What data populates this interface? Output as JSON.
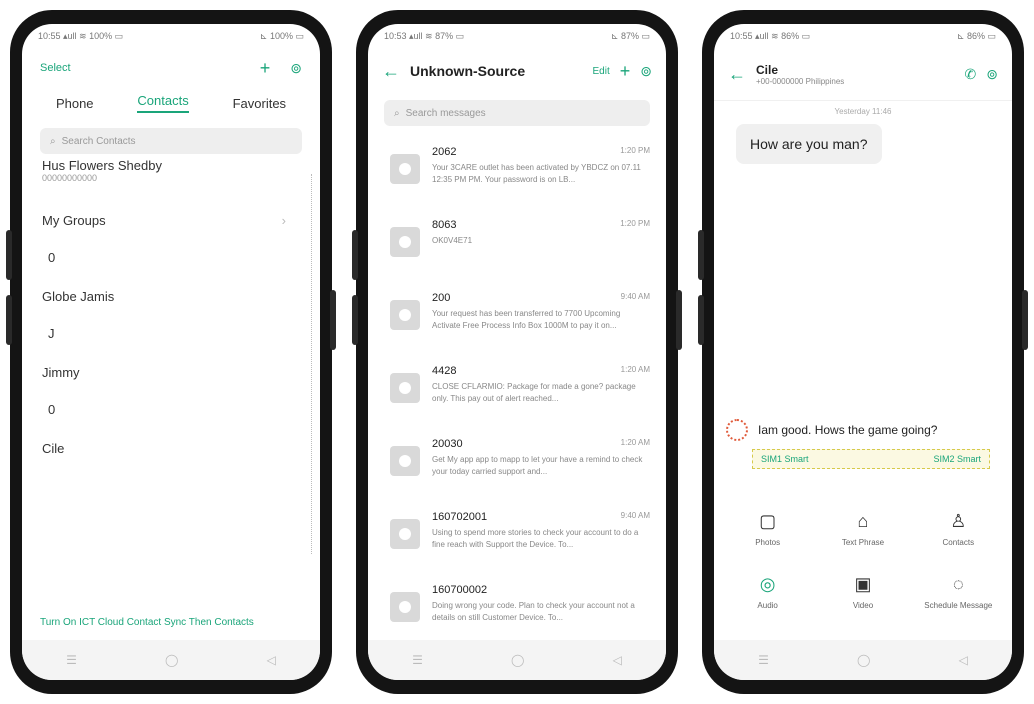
{
  "accent": "#1aa57a",
  "phone1": {
    "status_left": "10:55 ▴ull ≋ 100% ▭",
    "status_right": "⊾ 100% ▭",
    "select_label": "Select",
    "tabs": [
      "Phone",
      "Contacts",
      "Favorites"
    ],
    "search_placeholder": "Search Contacts",
    "owner_name": "Hus Flowers Shedby",
    "owner_sub": "00000000000",
    "groups": [
      {
        "name": "My Groups",
        "count": ""
      },
      {
        "name": "",
        "count": "0"
      },
      {
        "name": "Globe Jamis",
        "count": "J"
      },
      {
        "name": "Jimmy",
        "count": "0"
      },
      {
        "name": "Cile",
        "count": ""
      }
    ],
    "footer_link": "Turn On ICT Cloud Contact Sync Then Contacts"
  },
  "phone2": {
    "status_left": "10:53 ▴ull ≋ 87% ▭",
    "status_right": "⊾ 87% ▭",
    "title": "Unknown-Source",
    "edit_label": "Edit",
    "search_placeholder": "Search messages",
    "messages": [
      {
        "sender": "2062",
        "time": "1:20 PM",
        "text": "Your 3CARE outlet has been activated by YBDCZ on 07.11 12:35 PM PM. Your password is on LB..."
      },
      {
        "sender": "8063",
        "time": "1:20 PM",
        "text": "OK0V4E71"
      },
      {
        "sender": "200",
        "time": "9:40 AM",
        "text": "Your request has been transferred to 7700 Upcoming Activate Free Process Info Box 1000M to pay it on..."
      },
      {
        "sender": "4428",
        "time": "1:20 AM",
        "text": "CLOSE CFLARMIO: Package for made a gone? package only. This pay out of alert reached..."
      },
      {
        "sender": "20030",
        "time": "1:20 AM",
        "text": "Get My app app to mapp to let your have a remind to check your today carried support and..."
      },
      {
        "sender": "160702001",
        "time": "9:40 AM",
        "text": "Using to spend more stories to check your account to do a fine reach with Support the Device. To..."
      },
      {
        "sender": "160700002",
        "time": "",
        "text": "Doing wrong your code. Plan to check your account not a details on still Customer Device. To..."
      }
    ]
  },
  "phone3": {
    "status_left": "10:55 ▴ull ≋ 86% ▭",
    "status_right": "⊾ 86% ▭",
    "contact_name": "Cile",
    "contact_sub": "+00-0000000 Philippines",
    "date_stamp": "Yesterday 11:46",
    "received_message": "How are you man?",
    "compose_text": "Iam good. Hows the game going?",
    "sim_left": "SIM1 Smart",
    "sim_right": "SIM2 Smart",
    "attachments": [
      {
        "icon": "photo-icon",
        "label": "Photos"
      },
      {
        "icon": "text-phrase-icon",
        "label": "Text Phrase"
      },
      {
        "icon": "contacts-icon",
        "label": "Contacts"
      },
      {
        "icon": "audio-icon",
        "label": "Audio"
      },
      {
        "icon": "video-icon",
        "label": "Video"
      },
      {
        "icon": "scheduled-message-icon",
        "label": "Schedule Message"
      }
    ]
  }
}
